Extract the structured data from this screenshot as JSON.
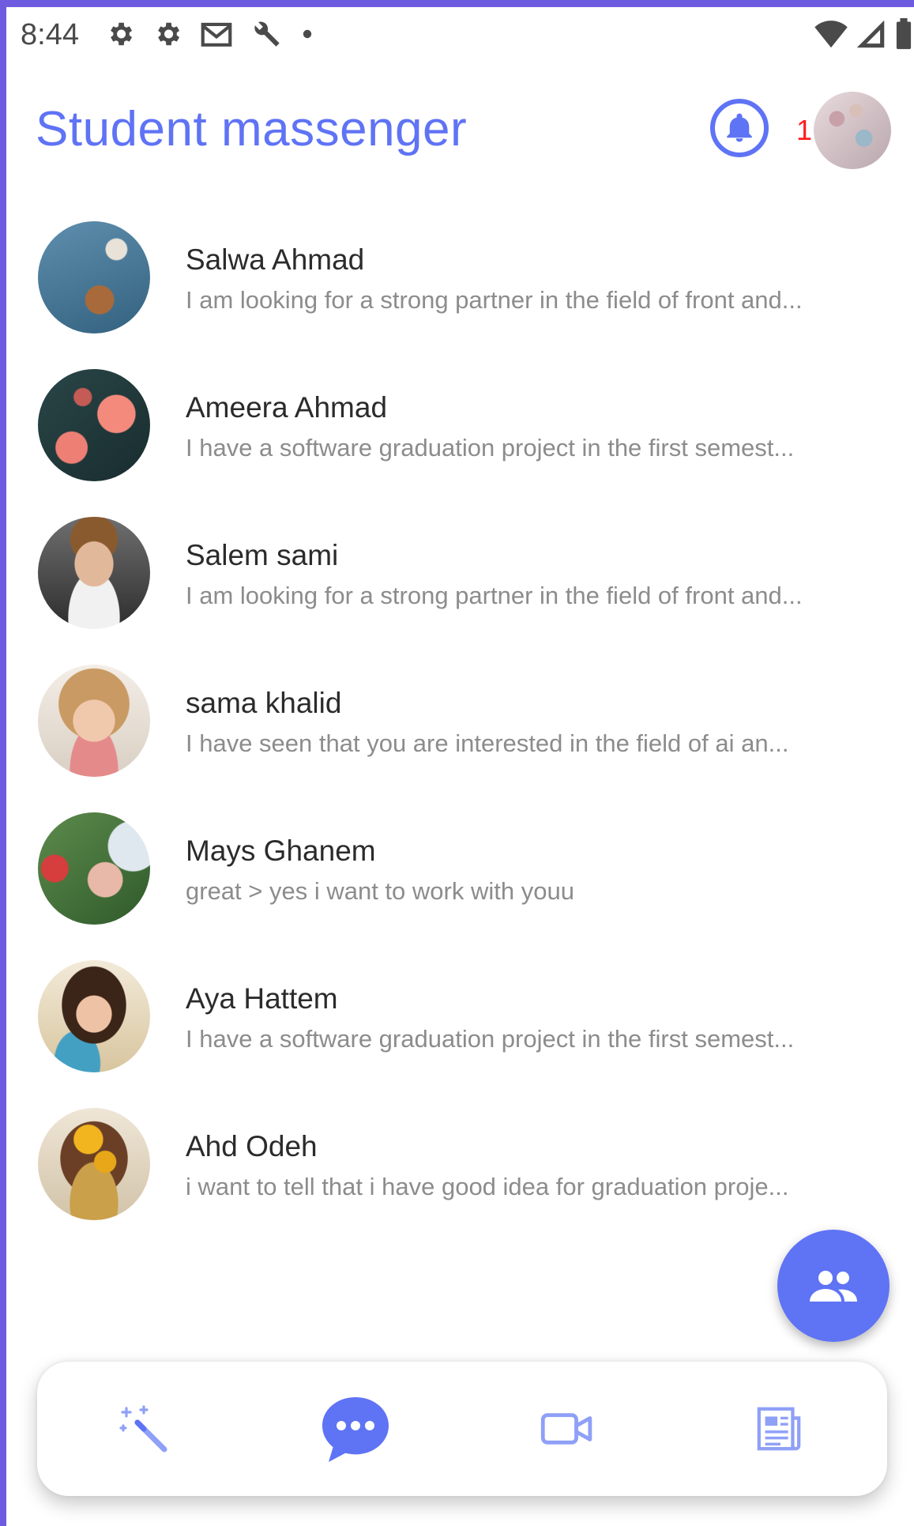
{
  "status_bar": {
    "time": "8:44",
    "icons": [
      "settings-icon",
      "settings-icon",
      "gmail-icon",
      "wrench-icon",
      "dot-icon"
    ],
    "right_icons": [
      "wifi-icon",
      "signal-icon",
      "battery-icon"
    ]
  },
  "header": {
    "title": "Student massenger",
    "notification_count": "1",
    "accent_color": "#5f73f5",
    "badge_color": "#ff1e1e"
  },
  "chats": [
    {
      "name": "Salwa Ahmad",
      "message": "I am looking for a strong partner in the field of front and..."
    },
    {
      "name": "Ameera Ahmad",
      "message": "I have a software graduation project in the first semest..."
    },
    {
      "name": "Salem sami",
      "message": "I am looking for a strong partner in the field of front and..."
    },
    {
      "name": "sama khalid",
      "message": "I have seen that you are interested in the field of ai an..."
    },
    {
      "name": "Mays Ghanem",
      "message": "great > yes i want to work with youu"
    },
    {
      "name": "Aya Hattem",
      "message": "I have a software graduation project in the first semest..."
    },
    {
      "name": "Ahd Odeh",
      "message": "i want to tell that i have good idea for graduation proje..."
    }
  ],
  "fab": {
    "icon": "group-icon"
  },
  "bottom_nav": {
    "items": [
      "magic-wand-icon",
      "chat-bubble-icon",
      "video-camera-icon",
      "newspaper-icon"
    ],
    "active": "chat-bubble-icon"
  }
}
